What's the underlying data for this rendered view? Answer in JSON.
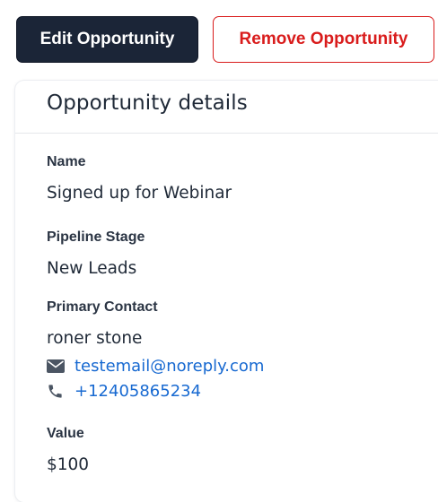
{
  "toolbar": {
    "edit_label": "Edit Opportunity",
    "remove_label": "Remove Opportunity"
  },
  "card": {
    "title": "Opportunity details",
    "fields": {
      "name": {
        "label": "Name",
        "value": "Signed up for Webinar"
      },
      "pipeline_stage": {
        "label": "Pipeline Stage",
        "value": "New Leads"
      },
      "primary_contact": {
        "label": "Primary Contact",
        "name": "roner stone",
        "email": "testemail@noreply.com",
        "phone": "+12405865234"
      },
      "value": {
        "label": "Value",
        "value": "$100"
      }
    }
  },
  "icons": {
    "email": "envelope-icon",
    "phone": "phone-icon"
  },
  "colors": {
    "edit_button_bg": "#1b2537",
    "remove_button": "#d91c1c",
    "link": "#1769d1"
  }
}
